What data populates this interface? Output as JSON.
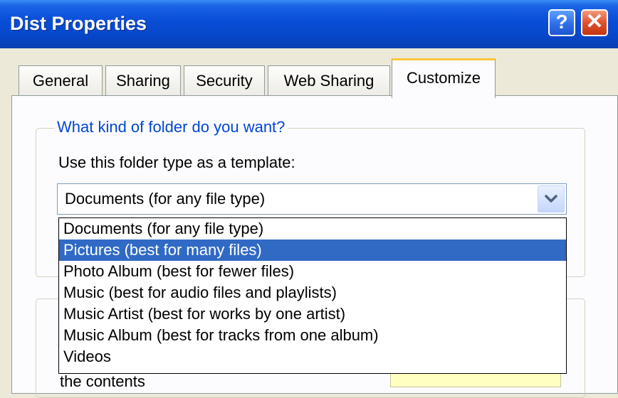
{
  "window": {
    "title": "Dist Properties",
    "help_label": "?",
    "close_label": "✕"
  },
  "tabs": [
    {
      "label": "General"
    },
    {
      "label": "Sharing"
    },
    {
      "label": "Security"
    },
    {
      "label": "Web Sharing"
    },
    {
      "label": "Customize",
      "active": true
    }
  ],
  "group": {
    "legend": "What kind of folder do you want?",
    "template_label": "Use this folder type as a template:",
    "selected_value": "Documents (for any file type)"
  },
  "dropdown": {
    "options": [
      "Documents (for any file type)",
      "Pictures (best for many files)",
      "Photo Album (best for fewer files)",
      "Music (best for audio files and playlists)",
      "Music Artist (best for works by one artist)",
      "Music Album (best for tracks from one album)",
      "Videos"
    ],
    "highlighted_index": 1
  },
  "partial_text": "the contents",
  "icons": {
    "dropdown": "chevron-down-icon"
  },
  "colors": {
    "title_bar": "#0a4fd8",
    "highlight": "#316ac5",
    "legend": "#0046d5",
    "active_tab_accent": "#ffc83c"
  }
}
